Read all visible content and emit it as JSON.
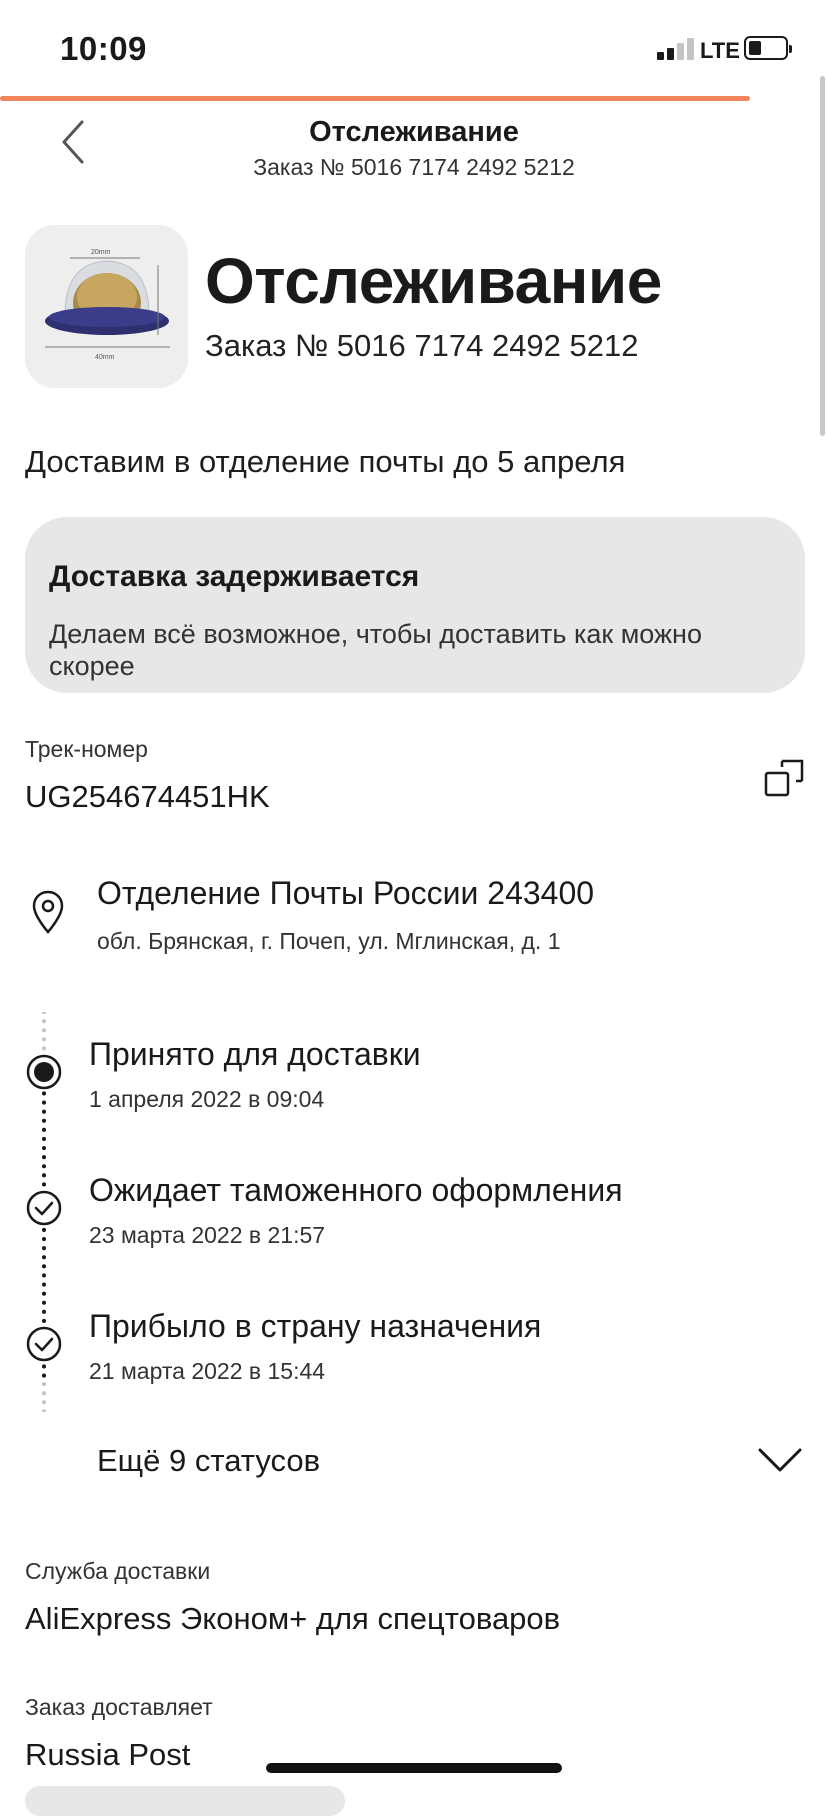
{
  "status_bar": {
    "time": "10:09",
    "network": "LTE"
  },
  "header": {
    "title": "Отслеживание",
    "subtitle": "Заказ № 5016 7174 2492 5212"
  },
  "product": {
    "title": "Отслеживание",
    "order": "Заказ № 5016 7174 2492 5212"
  },
  "delivery_estimate": "Доставим в отделение почты до 5 апреля",
  "alert": {
    "title": "Доставка задерживается",
    "text": "Делаем всё возможное, чтобы доставить как можно скорее"
  },
  "tracking": {
    "label": "Трек-номер",
    "number": "UG254674451HK"
  },
  "pickup": {
    "name": "Отделение Почты России 243400",
    "address": "обл. Брянская, г. Почеп, ул. Мглинская, д. 1"
  },
  "events": [
    {
      "title": "Принято для доставки",
      "date": "1 апреля 2022 в 09:04",
      "state": "current"
    },
    {
      "title": "Ожидает таможенного оформления",
      "date": "23 марта 2022 в 21:57",
      "state": "done"
    },
    {
      "title": "Прибыло в страну назначения",
      "date": "21 марта 2022 в 15:44",
      "state": "done"
    }
  ],
  "more_statuses": "Ещё 9 статусов",
  "service": {
    "label": "Служба доставки",
    "value": "AliExpress Эконом+ для спецтоваров"
  },
  "carrier": {
    "label": "Заказ доставляет",
    "value": "Russia Post"
  },
  "colors": {
    "accent": "#f0845a",
    "card": "#e7e7e7"
  }
}
